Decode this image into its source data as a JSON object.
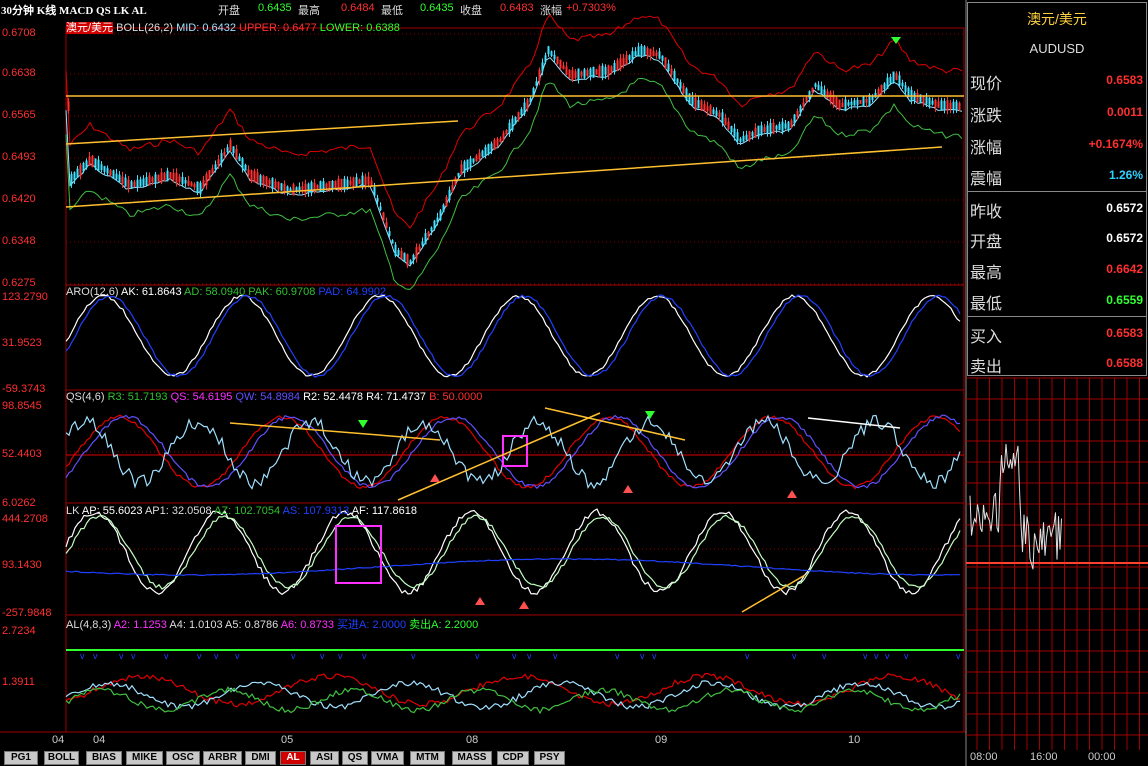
{
  "header": {
    "title": "30分钟 K线 MACD QS LK AL",
    "open_label": "开盘",
    "open_value": "0.6435",
    "high_label": "最高",
    "high_value": "0.6484",
    "low_label": "最低",
    "low_value": "0.6435",
    "close_label": "收盘",
    "close_value": "0.6483",
    "change_label": "涨幅",
    "change_value": "+0.7303%"
  },
  "panels": {
    "main": {
      "name": "澳元/美元",
      "indicator": "BOLL(26,2)",
      "mid": "MID: 0.6432",
      "upper": "UPPER: 0.6477",
      "lower": "LOWER: 0.6388",
      "y_ticks": [
        "0.6708",
        "0.6638",
        "0.6565",
        "0.6493",
        "0.6420",
        "0.6348",
        "0.6275"
      ]
    },
    "aro": {
      "name": "ARO(12,6)",
      "ak": "AK: 61.8643",
      "ad": "AD: 58.0940",
      "pak": "PAK: 60.9708",
      "pad": "PAD: 64.9902",
      "y_ticks": [
        "123.2790",
        "31.9523",
        "-59.3743"
      ]
    },
    "qs": {
      "name": "QS(4,6)",
      "r3": "R3: 51.7193",
      "qs": "QS: 54.6195",
      "qw": "QW: 54.8984",
      "r2": "R2: 52.4478",
      "r4": "R4: 71.4737",
      "b": "B: 50.0000",
      "y_ticks": [
        "98.8545",
        "52.4403",
        "6.0262"
      ]
    },
    "lk": {
      "name": "LK",
      "ap": "AP: 55.6023",
      "ap1": "AP1: 32.0508",
      "az": "AZ: 102.7054",
      "as": "AS: 107.9313",
      "af": "AF: 117.8618",
      "y_ticks": [
        "444.2708",
        "93.1430",
        "-257.9848"
      ]
    },
    "al": {
      "name": "AL(4,8,3)",
      "a2": "A2: 1.1253",
      "a4": "A4: 1.0103",
      "a5": "A5: 0.8786",
      "a6": "A6: 0.8733",
      "buy": "买进A: 2.0000",
      "sell": "卖出A: 2.2000",
      "y_ticks": [
        "2.7234",
        "1.3911"
      ]
    }
  },
  "x_axis": [
    "04",
    "04",
    "05",
    "08",
    "09",
    "10"
  ],
  "quote": {
    "name": "澳元/美元",
    "code": "AUDUSD",
    "rows": [
      {
        "label": "现价",
        "value": "0.6583",
        "color": "#ff3030"
      },
      {
        "label": "涨跌",
        "value": "0.0011",
        "color": "#ff3030"
      },
      {
        "label": "涨幅",
        "value": "+0.1674%",
        "color": "#ff3030"
      },
      {
        "label": "震幅",
        "value": "1.26%",
        "color": "#30d0ff"
      },
      {
        "label": "昨收",
        "value": "0.6572",
        "color": "#ffffff"
      },
      {
        "label": "开盘",
        "value": "0.6572",
        "color": "#ffffff"
      },
      {
        "label": "最高",
        "value": "0.6642",
        "color": "#ff3030"
      },
      {
        "label": "最低",
        "value": "0.6559",
        "color": "#30ff30"
      },
      {
        "label": "买入",
        "value": "0.6583",
        "color": "#ff3030"
      },
      {
        "label": "卖出",
        "value": "0.6588",
        "color": "#ff3030"
      }
    ]
  },
  "mini_chart": {
    "x_ticks": [
      "08:00",
      "16:00",
      "00:00"
    ]
  },
  "tabs": [
    {
      "label": "PG1"
    },
    {
      "label": "BOLL"
    },
    {
      "label": "BIAS"
    },
    {
      "label": "MIKE"
    },
    {
      "label": "OSC"
    },
    {
      "label": "ARBR"
    },
    {
      "label": "DMI"
    },
    {
      "label": "AL",
      "active": true
    },
    {
      "label": "ASI"
    },
    {
      "label": "QS"
    },
    {
      "label": "VMA"
    },
    {
      "label": "MTM"
    },
    {
      "label": "MASS"
    },
    {
      "label": "CDP"
    },
    {
      "label": "PSY"
    }
  ],
  "colors": {
    "up": "#ff3030",
    "down": "#40e0ff",
    "grid": "#8a0000",
    "frame": "#a00000",
    "trend": "#ffc030",
    "mid": "#9fe0ff",
    "upper": "#e00000",
    "lower": "#40c040",
    "white": "#ffffff",
    "blue": "#2040ff",
    "magenta": "#ff30ff",
    "green": "#30ff30"
  }
}
